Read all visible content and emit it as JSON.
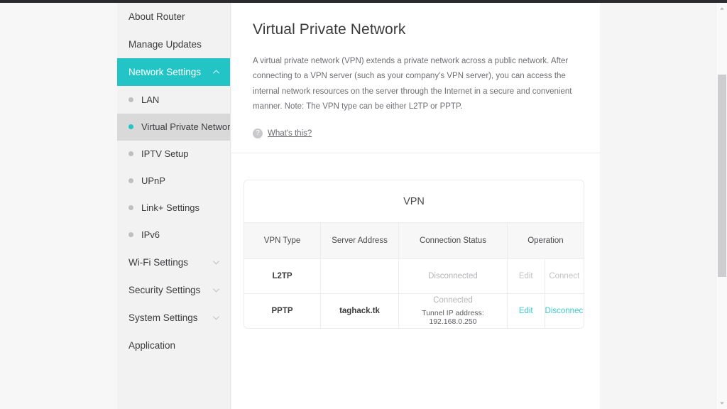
{
  "window": {
    "accent_color": "#23c4c6",
    "link_color": "#3fc8ca",
    "disabled_color": "#c3c3c6"
  },
  "sidebar": {
    "items": [
      {
        "label": "About Router",
        "type": "top",
        "state": "normal",
        "icon": ""
      },
      {
        "label": "Manage Updates",
        "type": "top",
        "state": "normal",
        "icon": ""
      },
      {
        "label": "Network Settings",
        "type": "top",
        "state": "active-expanded",
        "icon": "chevron-up-icon"
      }
    ],
    "sub_items": [
      {
        "label": "LAN",
        "selected": false
      },
      {
        "label": "Virtual Private Network",
        "selected": true
      },
      {
        "label": "IPTV Setup",
        "selected": false
      },
      {
        "label": "UPnP",
        "selected": false
      },
      {
        "label": "Link+ Settings",
        "selected": false
      },
      {
        "label": "IPv6",
        "selected": false
      }
    ],
    "bottom_items": [
      {
        "label": "Wi-Fi Settings",
        "icon": "chevron-down-icon"
      },
      {
        "label": "Security Settings",
        "icon": "chevron-down-icon"
      },
      {
        "label": "System Settings",
        "icon": "chevron-down-icon"
      },
      {
        "label": "Application",
        "icon": ""
      }
    ]
  },
  "main": {
    "title": "Virtual Private Network",
    "description": "A virtual private network (VPN) extends a private network across a public network. After connecting to a VPN server (such as your company’s VPN server), you can access the internal network resources on the server through the Internet in a secure and convenient manner. Note: The VPN type can be either L2TP or PPTP.",
    "help_icon": "question-mark-icon",
    "help_link": "What's this?"
  },
  "card": {
    "title": "VPN",
    "columns": {
      "type": "VPN Type",
      "address": "Server Address",
      "status": "Connection Status",
      "operation": "Operation"
    },
    "rows": [
      {
        "type": "L2TP",
        "address": "",
        "status": "Disconnected",
        "status_detail": "",
        "edit_label": "Edit",
        "action_label": "Connect",
        "enabled": false
      },
      {
        "type": "PPTP",
        "address": "taghack.tk",
        "status": "Connected",
        "status_detail": "Tunnel IP address: 192.168.0.250",
        "edit_label": "Edit",
        "action_label": "Disconnect",
        "enabled": true
      }
    ]
  },
  "scrollbar": {
    "up_icon": "caret-up-icon",
    "down_icon": "caret-down-icon"
  }
}
